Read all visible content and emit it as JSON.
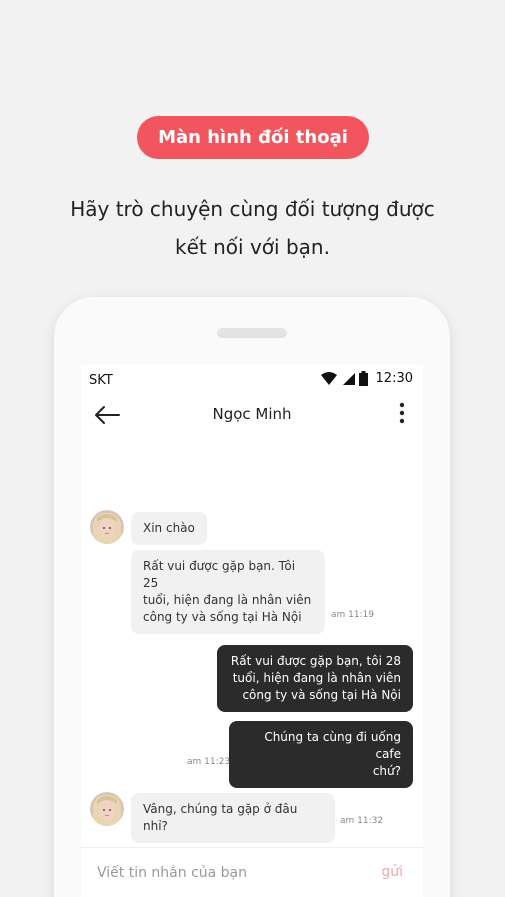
{
  "intro": {
    "badge": "Màn hình đối thoại",
    "subtitle_line1": "Hãy trò chuyện cùng đối tượng được",
    "subtitle_line2": "kết nối với bạn."
  },
  "statusbar": {
    "carrier": "SKT",
    "time": "12:30"
  },
  "chat": {
    "title": "Ngọc Minh",
    "messages": [
      {
        "side": "in",
        "text": "Xin chào"
      },
      {
        "side": "in",
        "text_lines": [
          "Rất vui được gặp bạn. Tôi 25",
          "tuổi, hiện đang là nhân viên",
          "công ty và sống tại Hà Nội"
        ],
        "time": "am 11:19"
      },
      {
        "side": "out",
        "text_lines": [
          "Rất vui được gặp bạn, tôi 28",
          "tuổi, hiện đang là nhân viên",
          "công ty và sống tại Hà Nội"
        ]
      },
      {
        "side": "out",
        "text_lines": [
          "Chúng ta cùng đi uống cafe",
          "chứ?"
        ],
        "time": "am 11:23"
      },
      {
        "side": "in",
        "text": "Vâng, chúng ta gặp ở đâu nhỉ?",
        "time": "am 11:32"
      }
    ]
  },
  "composer": {
    "placeholder": "Viết tin nhắn của bạn",
    "send_label": "gửi"
  },
  "colors": {
    "badge": "#f2555d",
    "outgoing_bubble": "#2b2b2b",
    "incoming_bubble": "#f1f1f1",
    "send": "#f3a8ac"
  },
  "icons": [
    "back-arrow-icon",
    "more-vertical-icon",
    "wifi-icon",
    "signal-icon",
    "battery-icon"
  ]
}
